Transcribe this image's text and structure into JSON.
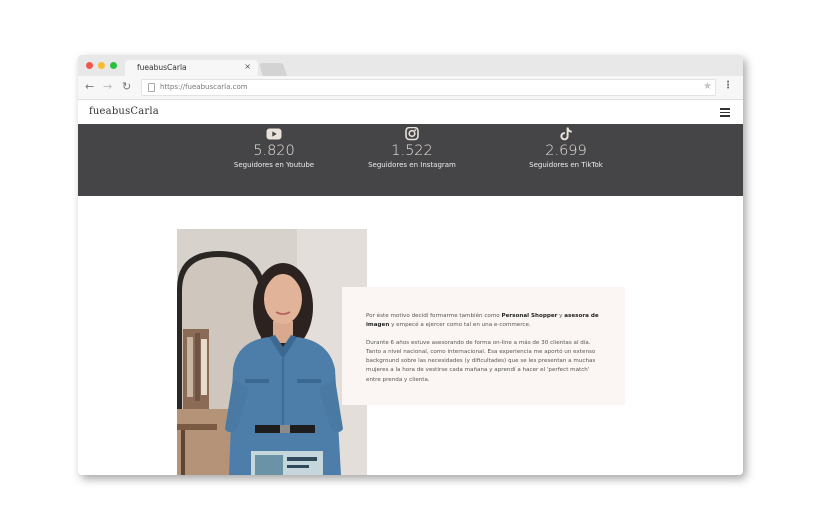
{
  "browser": {
    "tab_title": "fueabusCarla",
    "tab_close": "×",
    "url": "https://fueabuscarla.com",
    "nav": {
      "back": "←",
      "forward": "→",
      "reload": "↻"
    },
    "star": "★",
    "menu": "⋮"
  },
  "site": {
    "logo": "fueabusCarla",
    "menu_icon": "hamburger-icon"
  },
  "stats": [
    {
      "icon": "youtube-icon",
      "value": "5.820",
      "label": "Seguidores en Youtube"
    },
    {
      "icon": "instagram-icon",
      "value": "1.522",
      "label": "Seguidores en Instagram"
    },
    {
      "icon": "tiktok-icon",
      "value": "2.699",
      "label": "Seguidores en TikTok"
    }
  ],
  "about": {
    "p1_a": "Por éste motivo decidí formarme también como ",
    "p1_b": "Personal Shopper",
    "p1_c": " y ",
    "p1_d": "asesora de imagen",
    "p1_e": " y empecé a ejercer como tal en una e-commerce.",
    "p2": "Durante 6 años estuve asesorando de forma on-line a más de 30 clientas al día. Tanto a nivel nacional, como internacional. Esa experiencia me aportó un extenso background sobre las necesidades (y dificultades) que se les presentan a muchas mujeres a la hora de vestirse cada mañana y aprendí a hacer el 'perfect match' entre prenda y clienta."
  },
  "colors": {
    "stats_band": "#454547",
    "stats_accent": "#e9e2db",
    "textbox_bg": "#fbf6f3"
  }
}
